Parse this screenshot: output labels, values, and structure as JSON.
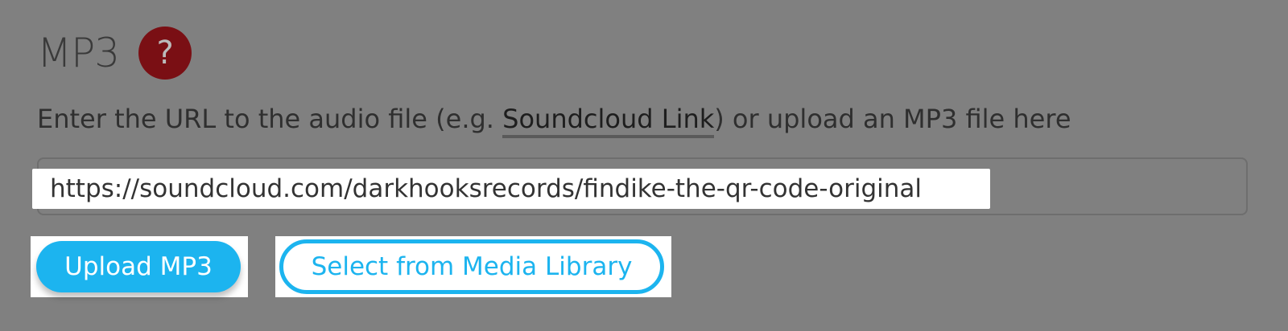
{
  "section": {
    "title": "MP3",
    "help_icon_symbol": "?",
    "help_icon_name": "question-mark-icon",
    "help_icon_color": "#7a0f14"
  },
  "instructions": {
    "before_link": "Enter the URL to the audio file (e.g. ",
    "link_text": "Soundcloud Link",
    "after_link": ") or upload an MP3 file here"
  },
  "url_input": {
    "value": "https://soundcloud.com/darkhooksrecords/findike-the-qr-code-original"
  },
  "buttons": {
    "upload_label": "Upload MP3",
    "library_label": "Select from Media Library"
  },
  "colors": {
    "background": "#808080",
    "accent": "#1cb4ef"
  }
}
